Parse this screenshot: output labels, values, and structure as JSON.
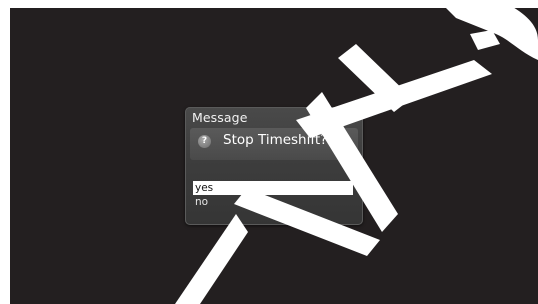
{
  "dialog": {
    "title": "Message",
    "icon": "question-icon",
    "icon_glyph": "?",
    "question": "Stop Timeshift?",
    "options": [
      {
        "label": "yes",
        "selected": true
      },
      {
        "label": "no",
        "selected": false
      }
    ]
  },
  "colors": {
    "screen_background": "#231f20",
    "selection": "#ffffff"
  }
}
